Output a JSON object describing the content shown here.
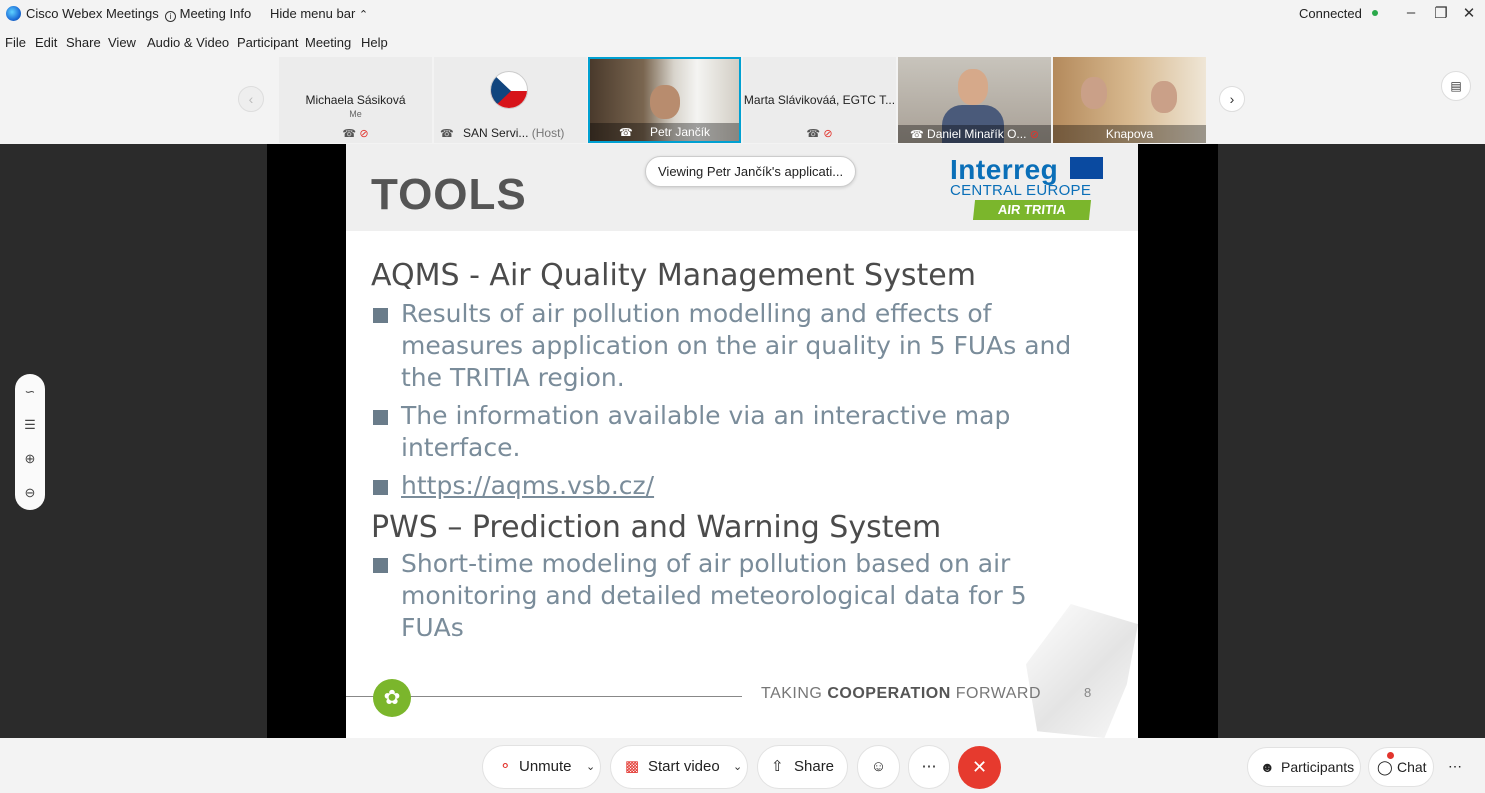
{
  "titlebar": {
    "app_name": "Cisco Webex Meetings",
    "meeting_info": "Meeting Info",
    "hide_menu": "Hide menu bar",
    "status": "Connected",
    "status_color": "#2aa84a"
  },
  "menu": [
    "File",
    "Edit",
    "Share",
    "View",
    "Audio & Video",
    "Participant",
    "Meeting",
    "Help"
  ],
  "participants": [
    {
      "name": "Michaela Sásiková",
      "sub": "Me",
      "muted": true
    },
    {
      "name": "SAN Servi...",
      "role": "(Host)",
      "muted": false
    },
    {
      "name": "Petr Jančík",
      "muted": false,
      "active": true
    },
    {
      "name": "Marta Slávikováá, EGTC T...",
      "muted": true
    },
    {
      "name": "Daniel Minařík O...",
      "muted": true
    },
    {
      "name": "Knapova",
      "muted": false
    }
  ],
  "viewing_pill": "Viewing Petr Jančík's applicati...",
  "slide": {
    "title": "TOOLS",
    "logo": {
      "main": "Interreg",
      "region": "CENTRAL EUROPE",
      "project": "AIR TRITIA"
    },
    "heading1": "AQMS - Air Quality Management System",
    "bullets1": [
      "Results of air pollution modelling and effects of measures application on the air quality in 5 FUAs and the TRITIA region.",
      "The information available via an interactive map interface."
    ],
    "link": "https://aqms.vsb.cz/",
    "heading2": "PWS – Prediction and Warning System",
    "bullets2": [
      "Short-time modeling of air pollution based on air monitoring and detailed meteorological data for 5 FUAs"
    ],
    "tagline_a": "TAKING",
    "tagline_b": "COOPERATION",
    "tagline_c": "FORWARD",
    "page_number": "8"
  },
  "controls": {
    "unmute": "Unmute",
    "start_video": "Start video",
    "share": "Share",
    "participants": "Participants",
    "chat": "Chat"
  },
  "colors": {
    "accent": "#00a0d1",
    "end_call": "#e63a2e",
    "brand_green": "#7bb62c"
  }
}
